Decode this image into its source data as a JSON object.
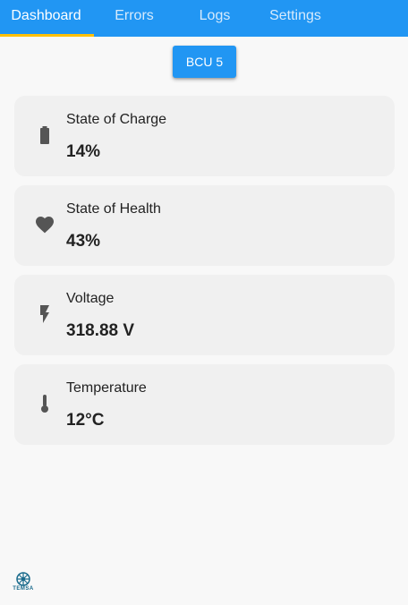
{
  "tabs": [
    {
      "label": "Dashboard",
      "active": true
    },
    {
      "label": "Errors",
      "active": false
    },
    {
      "label": "Logs",
      "active": false
    },
    {
      "label": "Settings",
      "active": false
    }
  ],
  "device_button": {
    "label": "BCU 5"
  },
  "cards": [
    {
      "title": "State of Charge",
      "value": "14%",
      "icon": "battery-icon"
    },
    {
      "title": "State of Health",
      "value": "43%",
      "icon": "heart-icon"
    },
    {
      "title": "Voltage",
      "value": "318.88 V",
      "icon": "lightning-bolt-icon"
    },
    {
      "title": "Temperature",
      "value": "12°C",
      "icon": "thermometer-icon"
    }
  ],
  "logo": {
    "text": "TEMSA"
  },
  "colors": {
    "primary": "#2196f3",
    "tab_indicator": "#ffc107",
    "card_background": "#f0f0f0",
    "icon": "#555555",
    "logo": "#1a6b8c"
  }
}
